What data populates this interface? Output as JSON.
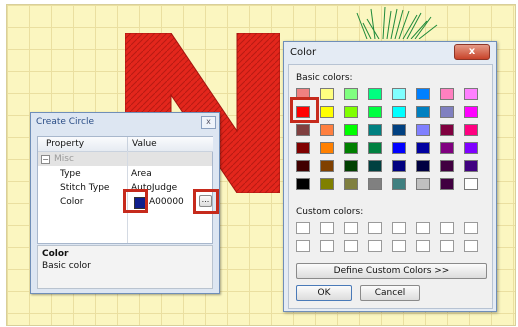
{
  "create_circle": {
    "title": "Create Circle",
    "close_glyph": "x",
    "headers": {
      "property": "Property",
      "value": "Value"
    },
    "group": {
      "expander": "−",
      "label": "Misc"
    },
    "rows": [
      {
        "property": "Type",
        "value": "Area"
      },
      {
        "property": "Stitch Type",
        "value": "AutoJudge"
      },
      {
        "property": "Color",
        "value": "A00000"
      }
    ],
    "ellipsis": "...",
    "description": {
      "title": "Color",
      "text": "Basic color"
    },
    "selected_color": "#0f1e8c"
  },
  "color_dialog": {
    "title": "Color",
    "close_glyph": "x",
    "basic_label": "Basic colors:",
    "custom_label": "Custom colors:",
    "define_button": "Define Custom Colors >>",
    "ok_button": "OK",
    "cancel_button": "Cancel",
    "basic_colors": [
      [
        "#f08080",
        "#ffff80",
        "#80ff80",
        "#00ff80",
        "#80ffff",
        "#0080ff",
        "#ff80c0",
        "#ff80ff"
      ],
      [
        "#ff0000",
        "#ffff00",
        "#80ff00",
        "#00ff40",
        "#00ffff",
        "#0080c0",
        "#8080c0",
        "#ff00ff"
      ],
      [
        "#804040",
        "#ff8040",
        "#00ff00",
        "#008080",
        "#004080",
        "#8080ff",
        "#800040",
        "#ff0080"
      ],
      [
        "#800000",
        "#ff8000",
        "#008000",
        "#008040",
        "#0000ff",
        "#0000a0",
        "#800080",
        "#8000ff"
      ],
      [
        "#400000",
        "#804000",
        "#004000",
        "#004040",
        "#000080",
        "#000040",
        "#400040",
        "#400080"
      ],
      [
        "#000000",
        "#808000",
        "#808040",
        "#808080",
        "#408080",
        "#c0c0c0",
        "#400040",
        "#ffffff"
      ]
    ],
    "selected_swatch": "row 2, column 1"
  },
  "colors": {
    "highlight": "#c62a1c",
    "embroidery_red": "#e3261c"
  }
}
